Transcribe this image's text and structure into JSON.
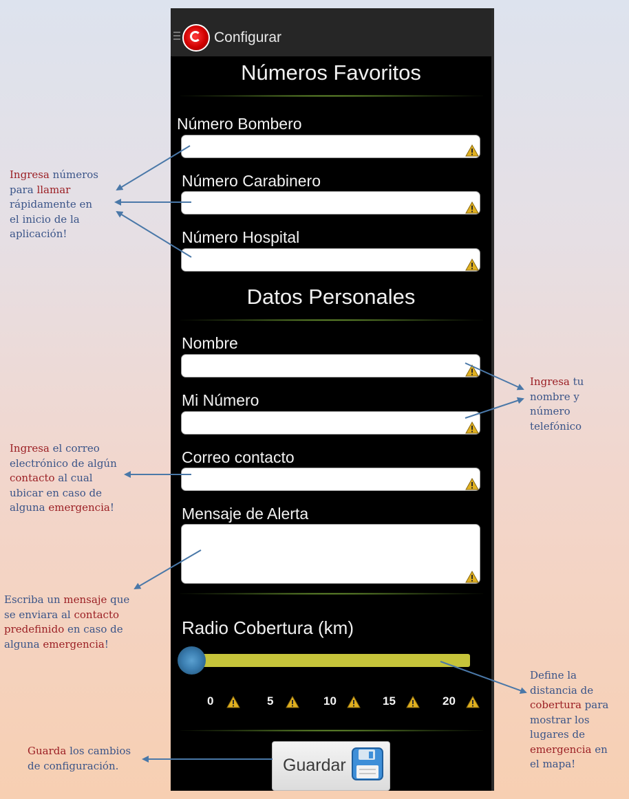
{
  "app_bar": {
    "title": "Configurar"
  },
  "sections": {
    "favorites_title": "Números Favoritos",
    "personal_title": "Datos Personales"
  },
  "fields": {
    "bombero_label": "Número Bombero",
    "carabinero_label": "Número Carabinero",
    "hospital_label": "Número Hospital",
    "nombre_label": "Nombre",
    "mi_numero_label": "Mi Número",
    "correo_label": "Correo contacto",
    "mensaje_label": "Mensaje de Alerta"
  },
  "slider": {
    "label": "Radio Cobertura (km)",
    "ticks": [
      "0",
      "5",
      "10",
      "15",
      "20"
    ],
    "value": 0
  },
  "save_button": {
    "label": "Guardar"
  },
  "annotations": {
    "numbers": [
      {
        "t": "Ingresa",
        "h": true
      },
      {
        "t": " números\n",
        "h": false
      },
      {
        "t": "para ",
        "h": false
      },
      {
        "t": "llamar",
        "h": true
      },
      {
        "t": "\nrápidamente en\nel inicio de  la\naplicación!",
        "h": false
      }
    ],
    "personal": [
      {
        "t": "Ingresa",
        "h": true
      },
      {
        "t": " tu\nnombre y\nnúmero\ntelefónico",
        "h": false
      }
    ],
    "email": [
      {
        "t": "Ingresa",
        "h": true
      },
      {
        "t": " el correo\nelectrónico de algún\n",
        "h": false
      },
      {
        "t": "contacto",
        "h": true
      },
      {
        "t": " al cual\nubicar en caso de\nalguna ",
        "h": false
      },
      {
        "t": "emergencia",
        "h": true
      },
      {
        "t": "!",
        "h": false
      }
    ],
    "message": [
      {
        "t": "Escriba un ",
        "h": false
      },
      {
        "t": "mensaje",
        "h": true
      },
      {
        "t": " que\nse enviara al ",
        "h": false
      },
      {
        "t": "contacto",
        "h": true
      },
      {
        "t": "\n",
        "h": false
      },
      {
        "t": "predefinido",
        "h": true
      },
      {
        "t": " en caso de\nalguna ",
        "h": false
      },
      {
        "t": "emergencia",
        "h": true
      },
      {
        "t": "!",
        "h": false
      }
    ],
    "distance": [
      {
        "t": "Define la\ndistancia de\n",
        "h": false
      },
      {
        "t": "cobertura",
        "h": true
      },
      {
        "t": " para\nmostrar los\nlugares de\n",
        "h": false
      },
      {
        "t": "emergencia",
        "h": true
      },
      {
        "t": " en\nel mapa!",
        "h": false
      }
    ],
    "save": [
      {
        "t": "Guarda",
        "h": true
      },
      {
        "t": " los cambios\nde configuración.",
        "h": false
      }
    ]
  },
  "colors": {
    "annotation_text": "#3a5488",
    "annotation_highlight": "#9b1f24",
    "slider_track": "#c6c43a",
    "slider_thumb": "#3b7eb1",
    "warning": "#e0b020",
    "arrow": "#4a78a8"
  }
}
